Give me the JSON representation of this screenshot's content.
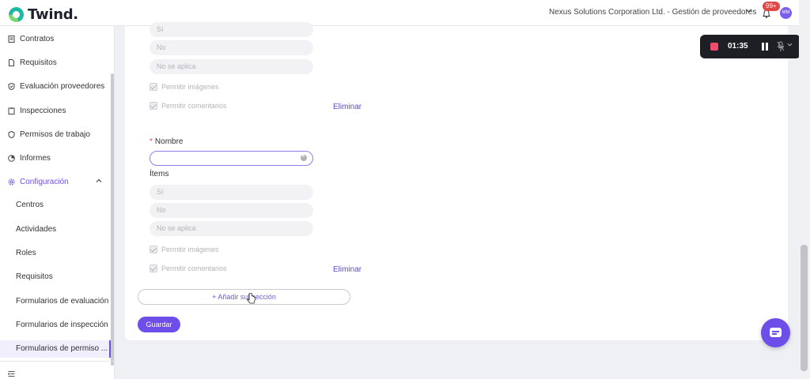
{
  "app": {
    "logo_text": "Twind."
  },
  "header": {
    "company": "Nexus Solutions Corporation Ltd. - Gestión de proveedores",
    "notifications_badge": "99+",
    "avatar_initials": "MM"
  },
  "sidebar": {
    "items": [
      {
        "label": "Contratos",
        "icon": "document-icon"
      },
      {
        "label": "Requisitos",
        "icon": "file-icon"
      },
      {
        "label": "Evaluación proveedores",
        "icon": "shield-check-icon"
      },
      {
        "label": "Inspecciones",
        "icon": "clipboard-icon"
      },
      {
        "label": "Permisos de trabajo",
        "icon": "shield-icon"
      },
      {
        "label": "Informes",
        "icon": "pie-chart-icon"
      },
      {
        "label": "Configuración",
        "icon": "gear-icon"
      }
    ],
    "sub_items": [
      "Centros",
      "Actividades",
      "Roles",
      "Requisitos",
      "Formularios de evaluación",
      "Formularios de inspección",
      "Formularios de permiso ..."
    ]
  },
  "form": {
    "section1": {
      "options": [
        "Sí",
        "No",
        "No se aplica"
      ],
      "allow_images": "Permitir imágenes",
      "allow_comments": "Permitir comentarios",
      "delete": "Eliminar"
    },
    "section2": {
      "name_label": "Nombre",
      "name_value": "",
      "items_label": "Ítems",
      "options": [
        "Sí",
        "No",
        "No se aplica"
      ],
      "allow_images": "Permitir imágenes",
      "allow_comments": "Permitir comentarios",
      "delete": "Eliminar"
    },
    "add_subsection": "+ Añadir subsección",
    "save": "Guardar"
  },
  "recording": {
    "time": "01:35"
  },
  "colors": {
    "accent": "#6e4ee8",
    "recording_dot": "#f04b6b"
  }
}
